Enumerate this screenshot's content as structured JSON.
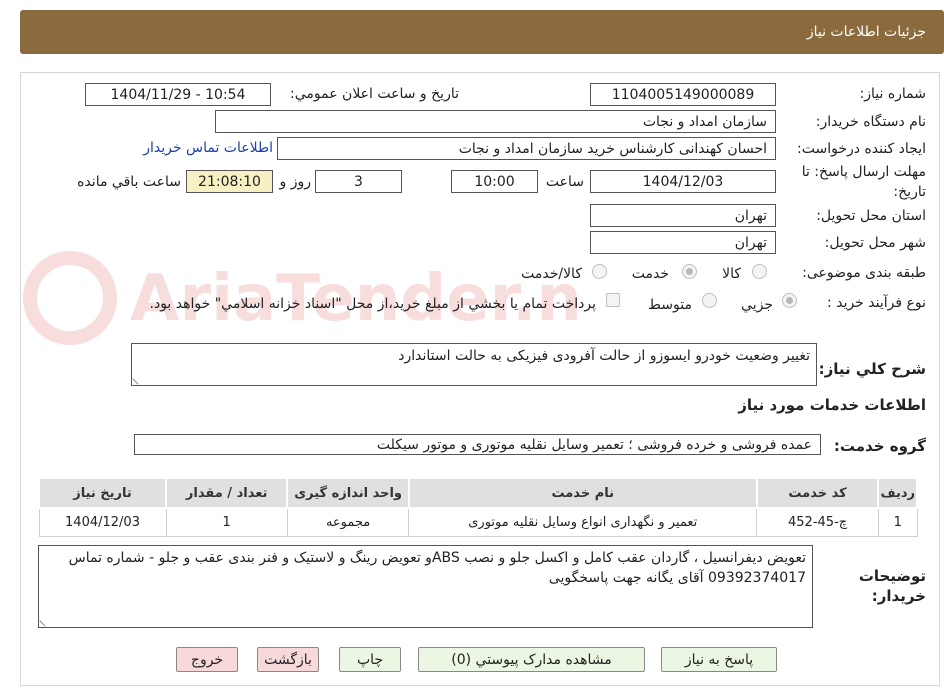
{
  "header": {
    "title": "جزئيات اطلاعات نياز"
  },
  "watermark": {
    "text": "AriaTender.neT"
  },
  "fields": {
    "need_number_label": "شماره نياز:",
    "need_number": "1104005149000089",
    "announce_label": "تاريخ و ساعت اعلان عمومي:",
    "announce_value": "1404/11/29 - 10:54",
    "buyer_org_label": "نام دستگاه خريدار:",
    "buyer_org": "سازمان امداد و نجات",
    "requester_label": "ايجاد کننده درخواست:",
    "requester": "احسان کهندانی کارشناس خرید  سازمان امداد و نجات",
    "contact_link": "اطلاعات تماس خريدار",
    "deadline_label_line1": "مهلت ارسال پاسخ: تا",
    "deadline_label_line2": "تاريخ:",
    "deadline_date": "1404/12/03",
    "time_label": "ساعت",
    "deadline_time": "10:00",
    "days_value": "3",
    "day_and_label": "روز و",
    "remaining_time": "21:08:10",
    "remaining_label": "ساعت باقي مانده",
    "province_label": "استان محل تحويل:",
    "province": "تهران",
    "city_label": "شهر محل تحويل:",
    "city": "تهران",
    "category_label": "طبقه بندی موضوعی:",
    "category_options": [
      "کالا",
      "خدمت",
      "کالا/خدمت"
    ],
    "category_selected": "خدمت",
    "process_label": "نوع فرآيند خريد :",
    "process_options": [
      "جزيي",
      "متوسط"
    ],
    "process_selected": "جزيي",
    "payment_note": "پرداخت تمام يا بخشي از مبلغ خريد،از محل \"اسناد خزانه اسلامي\" خواهد بود."
  },
  "description": {
    "label": "شرح کلي نياز:",
    "value": "تغییر وضعیت خودرو ایسوزو از حالت آفرودی فیزیکی به حالت استاندارد"
  },
  "services": {
    "section_title": "اطلاعات خدمات مورد نياز",
    "group_label": "گروه خدمت:",
    "group_value": "عمده فروشی و خرده فروشی ؛ تعمیر وسایل نقلیه موتوری و موتور سیکلت",
    "columns": [
      "رديف",
      "کد خدمت",
      "نام خدمت",
      "واحد اندازه گيری",
      "تعداد / مقدار",
      "تاريخ نياز"
    ],
    "rows": [
      [
        "1",
        "چ-45-452",
        "تعمیر و نگهداری انواع وسایل نقلیه موتوری",
        "مجموعه",
        "1",
        "1404/12/03"
      ]
    ]
  },
  "buyer_notes": {
    "label_line1": "توضيحات",
    "label_line2": "خريدار:",
    "value": "تعویض دیفرانسیل ، گاردان عقب کامل و اکسل جلو و نصب ABSو تعویض رینگ و لاستیک و فنر بندی عقب و جلو - شماره تماس 09392374017 آقای یگانه جهت پاسخگویی"
  },
  "buttons": {
    "reply": "پاسخ به نياز",
    "attachments": "مشاهده مدارک پيوستي (0)",
    "print": "چاپ",
    "back": "بازگشت",
    "exit": "خروج"
  },
  "colors": {
    "header_bg": "#8b6a3e",
    "link": "#1a3fa8",
    "green_btn": "#ebf7e2",
    "pink_btn": "#f8d9d9",
    "remaining_bg": "#f6f0c2"
  }
}
